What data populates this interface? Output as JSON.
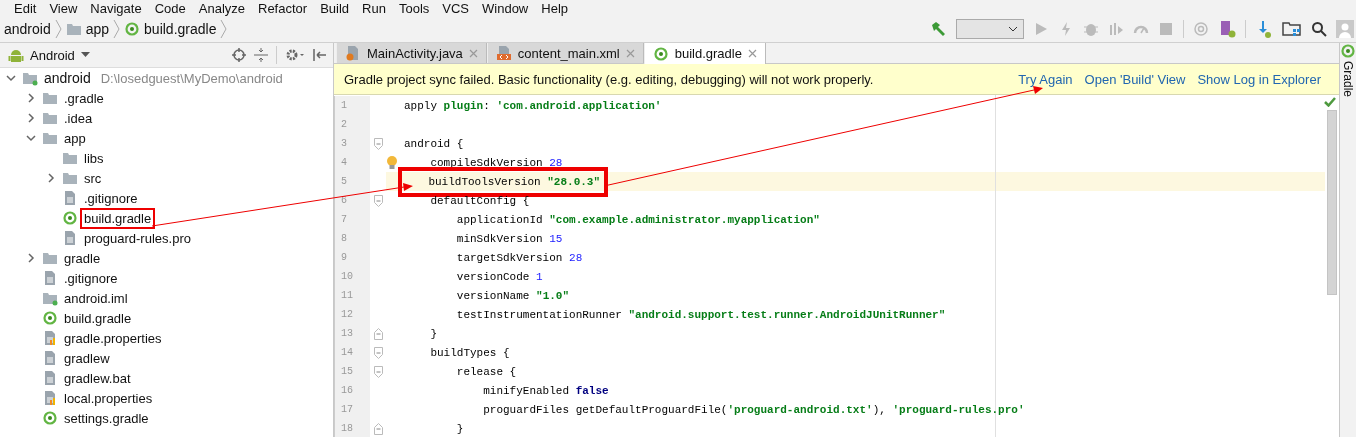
{
  "menu": [
    "Edit",
    "View",
    "Navigate",
    "Code",
    "Analyze",
    "Refactor",
    "Build",
    "Run",
    "Tools",
    "VCS",
    "Window",
    "Help"
  ],
  "breadcrumb": [
    {
      "label": "android",
      "kind": "module"
    },
    {
      "label": "app",
      "kind": "folder"
    },
    {
      "label": "build.gradle",
      "kind": "gradle"
    }
  ],
  "project_panel": {
    "view": "Android",
    "tree": [
      {
        "label": "android",
        "path": "D:\\losedguest\\MyDemo\\android",
        "kind": "module",
        "expanded": true,
        "annotated": false,
        "children": [
          {
            "label": ".gradle",
            "kind": "folder",
            "expanded": false,
            "annotated": false
          },
          {
            "label": ".idea",
            "kind": "folder",
            "expanded": false,
            "annotated": false
          },
          {
            "label": "app",
            "kind": "folder",
            "expanded": true,
            "annotated": false,
            "children": [
              {
                "label": "libs",
                "kind": "folder",
                "annotated": false
              },
              {
                "label": "src",
                "kind": "folder",
                "expanded": false,
                "annotated": false
              },
              {
                "label": ".gitignore",
                "kind": "file",
                "annotated": false
              },
              {
                "label": "build.gradle",
                "kind": "gradle",
                "annotated": true
              },
              {
                "label": "proguard-rules.pro",
                "kind": "file",
                "annotated": false
              }
            ]
          },
          {
            "label": "gradle",
            "kind": "folder",
            "expanded": false,
            "annotated": false
          },
          {
            "label": ".gitignore",
            "kind": "file",
            "annotated": false
          },
          {
            "label": "android.iml",
            "kind": "module",
            "annotated": false
          },
          {
            "label": "build.gradle",
            "kind": "gradle",
            "annotated": false
          },
          {
            "label": "gradle.properties",
            "kind": "properties",
            "annotated": false
          },
          {
            "label": "gradlew",
            "kind": "file",
            "annotated": false
          },
          {
            "label": "gradlew.bat",
            "kind": "file",
            "annotated": false
          },
          {
            "label": "local.properties",
            "kind": "properties",
            "annotated": false
          },
          {
            "label": "settings.gradle",
            "kind": "gradle",
            "annotated": false
          }
        ]
      }
    ]
  },
  "tabs": [
    {
      "label": "MainActivity.java",
      "kind": "java",
      "selected": false
    },
    {
      "label": "content_main.xml",
      "kind": "xml",
      "selected": false
    },
    {
      "label": "build.gradle",
      "kind": "gradle",
      "selected": true
    }
  ],
  "banner": {
    "message": "Gradle project sync failed. Basic functionality (e.g. editing, debugging) will not work properly.",
    "links": [
      "Try Again",
      "Open 'Build' View",
      "Show Log in Explorer"
    ]
  },
  "code": [
    {
      "number": "1",
      "kind": "plain",
      "current": false,
      "annotated": false,
      "bulb": false,
      "tokens": [
        {
          "kind": "plain",
          "text": "apply "
        },
        {
          "kind": "named",
          "text": "plugin"
        },
        {
          "kind": "plain",
          "text": ": "
        },
        {
          "kind": "string",
          "text": "'com.android.application'"
        }
      ]
    },
    {
      "number": "2",
      "kind": "plain",
      "current": false,
      "annotated": false,
      "bulb": false
    },
    {
      "number": "3",
      "kind": "fold_start",
      "current": false,
      "annotated": false,
      "bulb": false,
      "tokens": [
        {
          "kind": "plain",
          "text": "android {"
        }
      ]
    },
    {
      "number": "4",
      "kind": "plain",
      "current": false,
      "annotated": false,
      "bulb": true,
      "tokens": [
        {
          "kind": "plain",
          "text": "    compileSdkVersion "
        },
        {
          "kind": "number",
          "text": "28"
        }
      ]
    },
    {
      "number": "5",
      "kind": "plain",
      "current": true,
      "annotated": true,
      "bulb": false,
      "tokens": [
        {
          "kind": "plain",
          "text": "    buildToolsVersion "
        },
        {
          "kind": "string",
          "text": "\"28.0.3\""
        }
      ]
    },
    {
      "number": "6",
      "kind": "fold_start",
      "current": false,
      "annotated": false,
      "bulb": false,
      "tokens": [
        {
          "kind": "plain",
          "text": "    defaultConfig {"
        }
      ]
    },
    {
      "number": "7",
      "kind": "plain",
      "current": false,
      "annotated": false,
      "bulb": false,
      "tokens": [
        {
          "kind": "plain",
          "text": "        applicationId "
        },
        {
          "kind": "string",
          "text": "\"com.example.administrator.myapplication\""
        }
      ]
    },
    {
      "number": "8",
      "kind": "plain",
      "current": false,
      "annotated": false,
      "bulb": false,
      "tokens": [
        {
          "kind": "plain",
          "text": "        minSdkVersion "
        },
        {
          "kind": "number",
          "text": "15"
        }
      ]
    },
    {
      "number": "9",
      "kind": "plain",
      "current": false,
      "annotated": false,
      "bulb": false,
      "tokens": [
        {
          "kind": "plain",
          "text": "        targetSdkVersion "
        },
        {
          "kind": "number",
          "text": "28"
        }
      ]
    },
    {
      "number": "10",
      "kind": "plain",
      "current": false,
      "annotated": false,
      "bulb": false,
      "tokens": [
        {
          "kind": "plain",
          "text": "        versionCode "
        },
        {
          "kind": "number",
          "text": "1"
        }
      ]
    },
    {
      "number": "11",
      "kind": "plain",
      "current": false,
      "annotated": false,
      "bulb": false,
      "tokens": [
        {
          "kind": "plain",
          "text": "        versionName "
        },
        {
          "kind": "string",
          "text": "\"1.0\""
        }
      ]
    },
    {
      "number": "12",
      "kind": "plain",
      "current": false,
      "annotated": false,
      "bulb": false,
      "tokens": [
        {
          "kind": "plain",
          "text": "        testInstrumentationRunner "
        },
        {
          "kind": "string",
          "text": "\"android.support.test.runner.AndroidJUnitRunner\""
        }
      ]
    },
    {
      "number": "13",
      "kind": "fold_end",
      "current": false,
      "annotated": false,
      "bulb": false,
      "tokens": [
        {
          "kind": "plain",
          "text": "    }"
        }
      ]
    },
    {
      "number": "14",
      "kind": "fold_start",
      "current": false,
      "annotated": false,
      "bulb": false,
      "tokens": [
        {
          "kind": "plain",
          "text": "    buildTypes {"
        }
      ]
    },
    {
      "number": "15",
      "kind": "fold_start",
      "current": false,
      "annotated": false,
      "bulb": false,
      "tokens": [
        {
          "kind": "plain",
          "text": "        release {"
        }
      ]
    },
    {
      "number": "16",
      "kind": "plain",
      "current": false,
      "annotated": false,
      "bulb": false,
      "tokens": [
        {
          "kind": "plain",
          "text": "            minifyEnabled "
        },
        {
          "kind": "keyword",
          "text": "false"
        }
      ]
    },
    {
      "number": "17",
      "kind": "plain",
      "current": false,
      "annotated": false,
      "bulb": false,
      "tokens": [
        {
          "kind": "plain",
          "text": "            proguardFiles getDefaultProguardFile("
        },
        {
          "kind": "string",
          "text": "'proguard-android.txt'"
        },
        {
          "kind": "plain",
          "text": "), "
        },
        {
          "kind": "string",
          "text": "'proguard-rules.pro'"
        }
      ]
    },
    {
      "number": "18",
      "kind": "fold_end",
      "current": false,
      "annotated": false,
      "bulb": false,
      "tokens": [
        {
          "kind": "plain",
          "text": "        }"
        }
      ]
    }
  ],
  "side_stripe": {
    "label": "Gradle"
  }
}
